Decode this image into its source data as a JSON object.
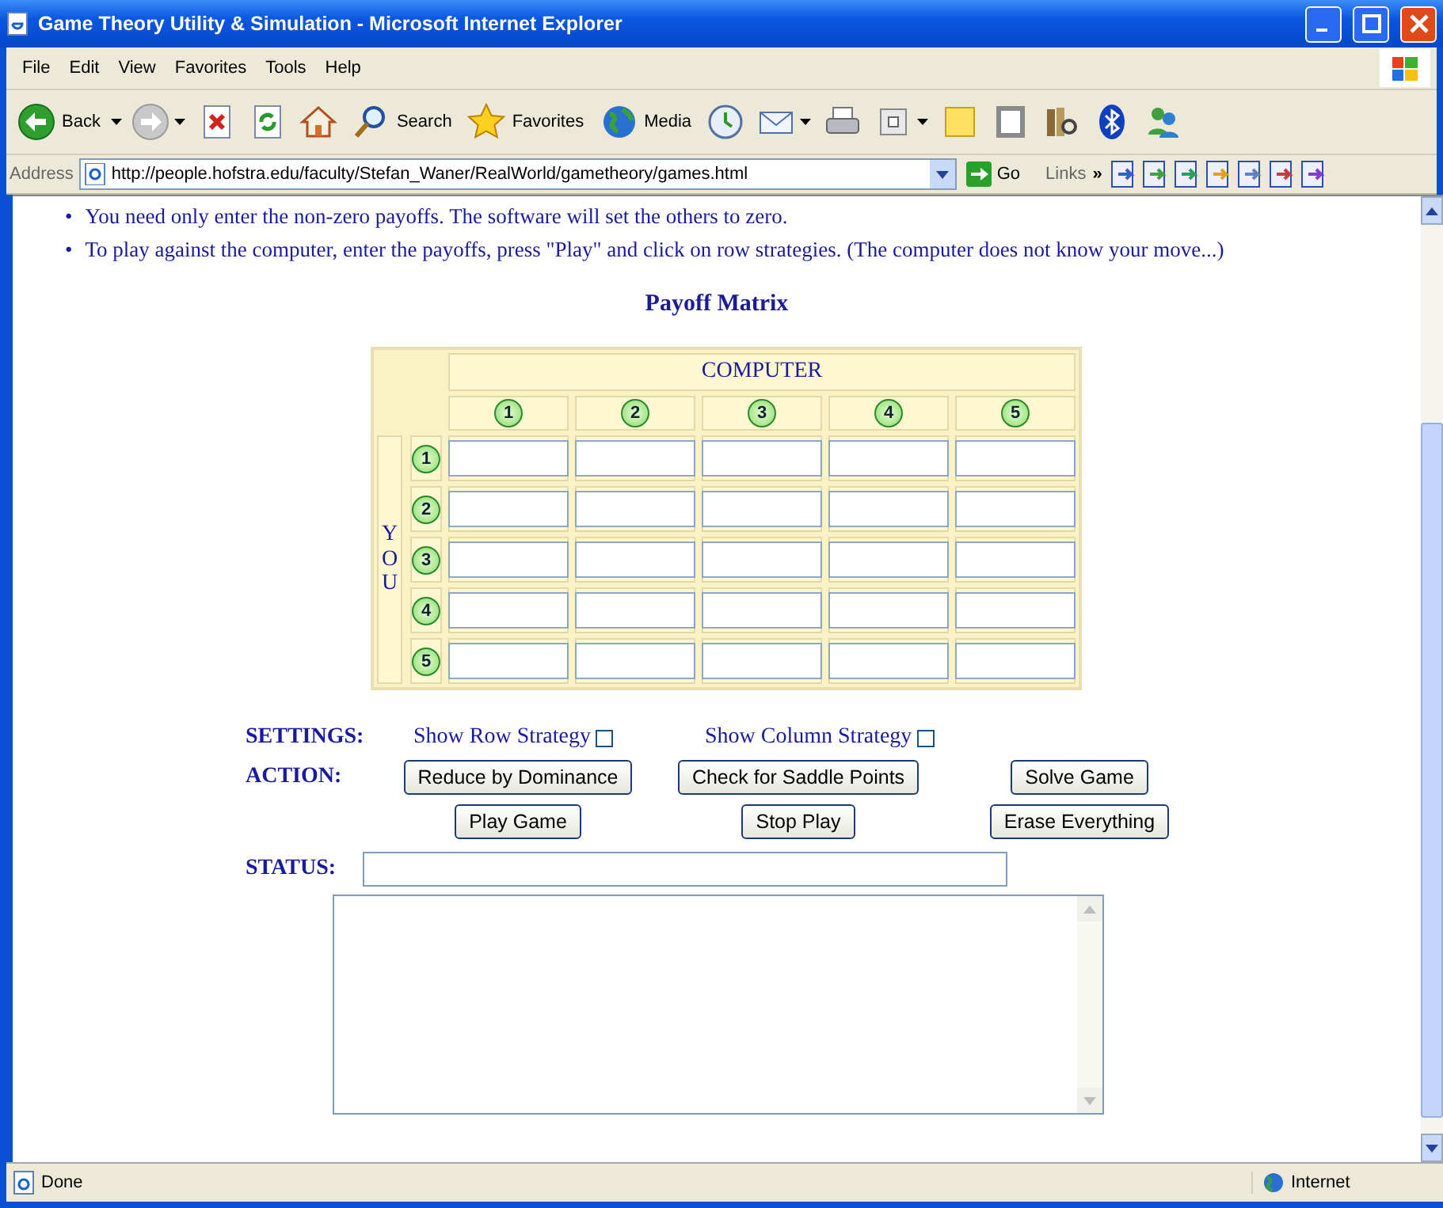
{
  "window": {
    "title": "Game Theory Utility & Simulation - Microsoft Internet Explorer"
  },
  "menu": [
    "File",
    "Edit",
    "View",
    "Favorites",
    "Tools",
    "Help"
  ],
  "toolbar": [
    {
      "kind": "back",
      "label": "Back",
      "dropdown": true
    },
    {
      "kind": "forward",
      "dropdown": true
    },
    {
      "kind": "stop"
    },
    {
      "kind": "refresh"
    },
    {
      "kind": "home"
    },
    {
      "kind": "search",
      "label": "Search"
    },
    {
      "kind": "favorites",
      "label": "Favorites"
    },
    {
      "kind": "media",
      "label": "Media"
    },
    {
      "kind": "history"
    },
    {
      "kind": "mail",
      "dropdown": true
    },
    {
      "kind": "print"
    },
    {
      "kind": "edit",
      "dropdown": true
    },
    {
      "kind": "note"
    },
    {
      "kind": "research"
    },
    {
      "kind": "library"
    },
    {
      "kind": "bluetooth"
    },
    {
      "kind": "people"
    }
  ],
  "address": {
    "label": "Address",
    "url": "http://people.hofstra.edu/faculty/Stefan_Waner/RealWorld/gametheory/games.html",
    "go": "Go",
    "links": "Links",
    "chevron": "»"
  },
  "page": {
    "bullets": [
      {
        "marker": "•",
        "text": "You need only enter the non-zero payoffs. The software will set the others to zero."
      },
      {
        "marker": "•",
        "text": "To play against the computer, enter the payoffs, press \"Play\" and click on row strategies. (The computer does not know your move...)"
      }
    ],
    "heading": "Payoff Matrix",
    "matrix": {
      "column_header": "COMPUTER",
      "row_header": "YOU",
      "columns": [
        "1",
        "2",
        "3",
        "4",
        "5"
      ],
      "rows": [
        "1",
        "2",
        "3",
        "4",
        "5"
      ]
    },
    "settings": {
      "label": "SETTINGS:",
      "options": [
        {
          "label": "Show Row Strategy",
          "checked": false
        },
        {
          "label": "Show Column Strategy",
          "checked": false
        }
      ]
    },
    "action": {
      "label": "ACTION:",
      "buttons": [
        "Reduce by Dominance",
        "Check for Saddle Points",
        "Solve Game",
        "Play Game",
        "Stop Play",
        "Erase Everything"
      ]
    },
    "status": {
      "label": "STATUS:"
    }
  },
  "status_bar": {
    "text": "Done",
    "zone": "Internet"
  }
}
